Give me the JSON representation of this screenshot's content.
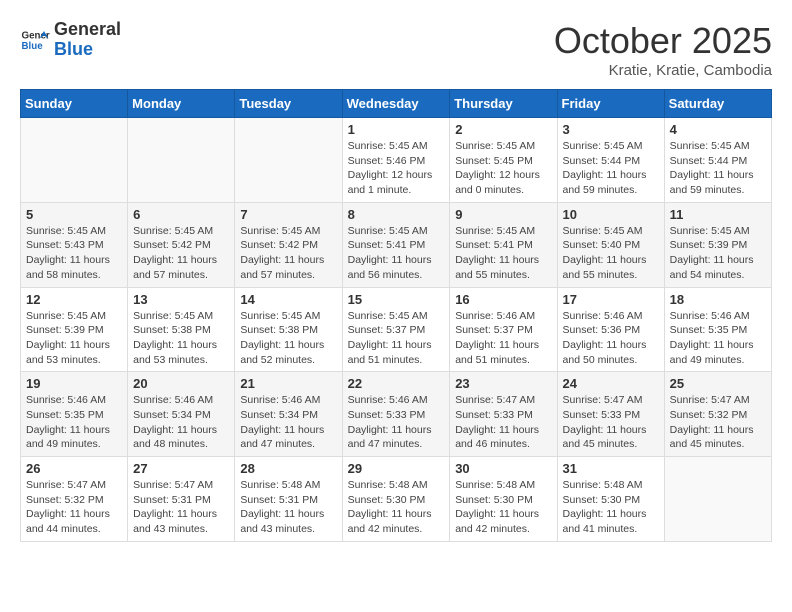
{
  "header": {
    "logo_general": "General",
    "logo_blue": "Blue",
    "month_title": "October 2025",
    "location": "Kratie, Kratie, Cambodia"
  },
  "days_of_week": [
    "Sunday",
    "Monday",
    "Tuesday",
    "Wednesday",
    "Thursday",
    "Friday",
    "Saturday"
  ],
  "weeks": [
    [
      {
        "day": "",
        "info": ""
      },
      {
        "day": "",
        "info": ""
      },
      {
        "day": "",
        "info": ""
      },
      {
        "day": "1",
        "info": "Sunrise: 5:45 AM\nSunset: 5:46 PM\nDaylight: 12 hours\nand 1 minute."
      },
      {
        "day": "2",
        "info": "Sunrise: 5:45 AM\nSunset: 5:45 PM\nDaylight: 12 hours\nand 0 minutes."
      },
      {
        "day": "3",
        "info": "Sunrise: 5:45 AM\nSunset: 5:44 PM\nDaylight: 11 hours\nand 59 minutes."
      },
      {
        "day": "4",
        "info": "Sunrise: 5:45 AM\nSunset: 5:44 PM\nDaylight: 11 hours\nand 59 minutes."
      }
    ],
    [
      {
        "day": "5",
        "info": "Sunrise: 5:45 AM\nSunset: 5:43 PM\nDaylight: 11 hours\nand 58 minutes."
      },
      {
        "day": "6",
        "info": "Sunrise: 5:45 AM\nSunset: 5:42 PM\nDaylight: 11 hours\nand 57 minutes."
      },
      {
        "day": "7",
        "info": "Sunrise: 5:45 AM\nSunset: 5:42 PM\nDaylight: 11 hours\nand 57 minutes."
      },
      {
        "day": "8",
        "info": "Sunrise: 5:45 AM\nSunset: 5:41 PM\nDaylight: 11 hours\nand 56 minutes."
      },
      {
        "day": "9",
        "info": "Sunrise: 5:45 AM\nSunset: 5:41 PM\nDaylight: 11 hours\nand 55 minutes."
      },
      {
        "day": "10",
        "info": "Sunrise: 5:45 AM\nSunset: 5:40 PM\nDaylight: 11 hours\nand 55 minutes."
      },
      {
        "day": "11",
        "info": "Sunrise: 5:45 AM\nSunset: 5:39 PM\nDaylight: 11 hours\nand 54 minutes."
      }
    ],
    [
      {
        "day": "12",
        "info": "Sunrise: 5:45 AM\nSunset: 5:39 PM\nDaylight: 11 hours\nand 53 minutes."
      },
      {
        "day": "13",
        "info": "Sunrise: 5:45 AM\nSunset: 5:38 PM\nDaylight: 11 hours\nand 53 minutes."
      },
      {
        "day": "14",
        "info": "Sunrise: 5:45 AM\nSunset: 5:38 PM\nDaylight: 11 hours\nand 52 minutes."
      },
      {
        "day": "15",
        "info": "Sunrise: 5:45 AM\nSunset: 5:37 PM\nDaylight: 11 hours\nand 51 minutes."
      },
      {
        "day": "16",
        "info": "Sunrise: 5:46 AM\nSunset: 5:37 PM\nDaylight: 11 hours\nand 51 minutes."
      },
      {
        "day": "17",
        "info": "Sunrise: 5:46 AM\nSunset: 5:36 PM\nDaylight: 11 hours\nand 50 minutes."
      },
      {
        "day": "18",
        "info": "Sunrise: 5:46 AM\nSunset: 5:35 PM\nDaylight: 11 hours\nand 49 minutes."
      }
    ],
    [
      {
        "day": "19",
        "info": "Sunrise: 5:46 AM\nSunset: 5:35 PM\nDaylight: 11 hours\nand 49 minutes."
      },
      {
        "day": "20",
        "info": "Sunrise: 5:46 AM\nSunset: 5:34 PM\nDaylight: 11 hours\nand 48 minutes."
      },
      {
        "day": "21",
        "info": "Sunrise: 5:46 AM\nSunset: 5:34 PM\nDaylight: 11 hours\nand 47 minutes."
      },
      {
        "day": "22",
        "info": "Sunrise: 5:46 AM\nSunset: 5:33 PM\nDaylight: 11 hours\nand 47 minutes."
      },
      {
        "day": "23",
        "info": "Sunrise: 5:47 AM\nSunset: 5:33 PM\nDaylight: 11 hours\nand 46 minutes."
      },
      {
        "day": "24",
        "info": "Sunrise: 5:47 AM\nSunset: 5:33 PM\nDaylight: 11 hours\nand 45 minutes."
      },
      {
        "day": "25",
        "info": "Sunrise: 5:47 AM\nSunset: 5:32 PM\nDaylight: 11 hours\nand 45 minutes."
      }
    ],
    [
      {
        "day": "26",
        "info": "Sunrise: 5:47 AM\nSunset: 5:32 PM\nDaylight: 11 hours\nand 44 minutes."
      },
      {
        "day": "27",
        "info": "Sunrise: 5:47 AM\nSunset: 5:31 PM\nDaylight: 11 hours\nand 43 minutes."
      },
      {
        "day": "28",
        "info": "Sunrise: 5:48 AM\nSunset: 5:31 PM\nDaylight: 11 hours\nand 43 minutes."
      },
      {
        "day": "29",
        "info": "Sunrise: 5:48 AM\nSunset: 5:30 PM\nDaylight: 11 hours\nand 42 minutes."
      },
      {
        "day": "30",
        "info": "Sunrise: 5:48 AM\nSunset: 5:30 PM\nDaylight: 11 hours\nand 42 minutes."
      },
      {
        "day": "31",
        "info": "Sunrise: 5:48 AM\nSunset: 5:30 PM\nDaylight: 11 hours\nand 41 minutes."
      },
      {
        "day": "",
        "info": ""
      }
    ]
  ]
}
